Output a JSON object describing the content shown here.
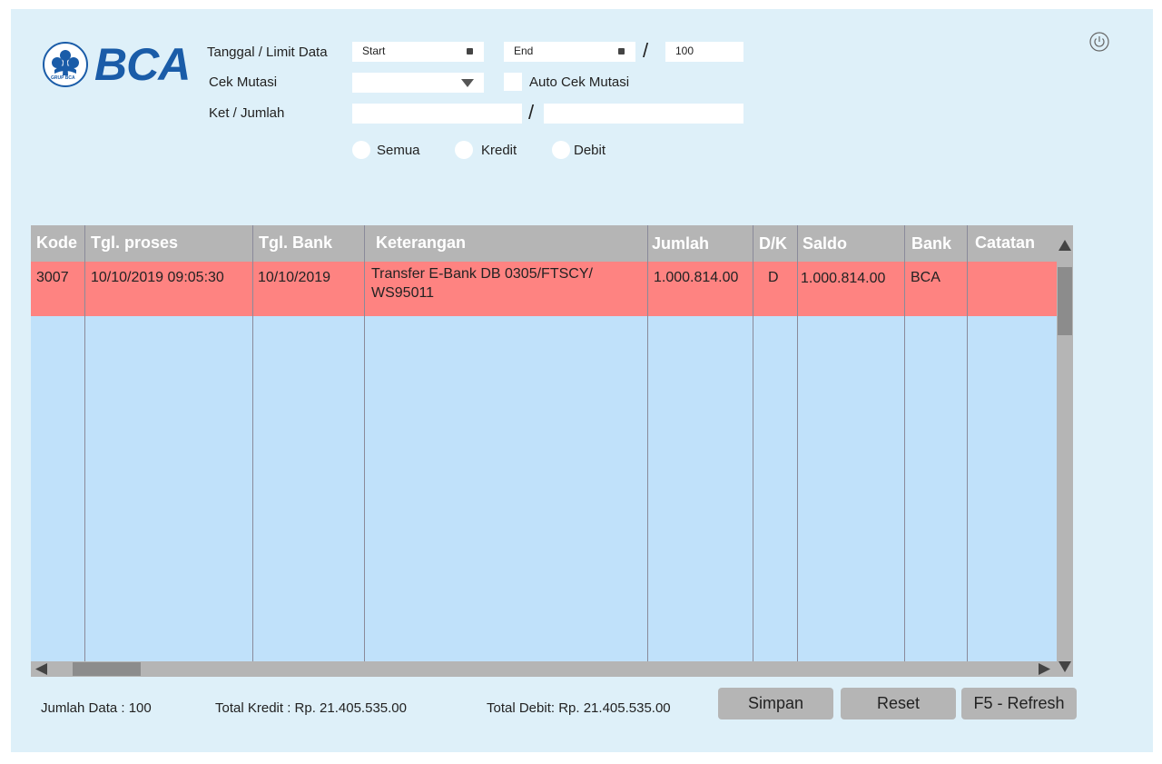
{
  "brand": {
    "name": "BCA",
    "logo_caption": "GRUP BCA",
    "color": "#1a5ca8"
  },
  "filters": {
    "date_label": "Tanggal / Limit Data",
    "start_placeholder": "Start",
    "end_placeholder": "End",
    "limit_value": "100",
    "mutasi_label": "Cek Mutasi",
    "auto_mutasi_label": "Auto Cek Mutasi",
    "ket_label": "Ket / Jumlah",
    "separator": "/",
    "radios": [
      "Semua",
      "Kredit",
      "Debit"
    ]
  },
  "icons": {
    "power": "power-icon",
    "calendar": "calendar-icon",
    "dropdown": "chevron-down-icon"
  },
  "table": {
    "columns": [
      "Kode",
      "Tgl. proses",
      "Tgl. Bank",
      "Keterangan",
      "Jumlah",
      "D/K",
      "Saldo",
      "Bank",
      "Catatan"
    ],
    "rows": [
      {
        "kode": "3007",
        "tgl_proses": "10/10/2019 09:05:30",
        "tgl_bank": "10/10/2019",
        "keterangan_1": "Transfer E-Bank DB 0305/FTSCY/",
        "keterangan_2": "WS95011",
        "jumlah": "1.000.814.00",
        "dk": "D",
        "saldo": "1.000.814.00",
        "bank": "BCA",
        "catatan": ""
      }
    ],
    "row_color": "#fe8381",
    "empty_color": "#c0e1fa"
  },
  "footer": {
    "jumlah_data": "Jumlah Data : 100",
    "total_kredit": "Total Kredit : Rp. 21.405.535.00",
    "total_debit": "Total Debit: Rp. 21.405.535.00"
  },
  "buttons": {
    "simpan": "Simpan",
    "reset": "Reset",
    "refresh": "F5 - Refresh"
  }
}
